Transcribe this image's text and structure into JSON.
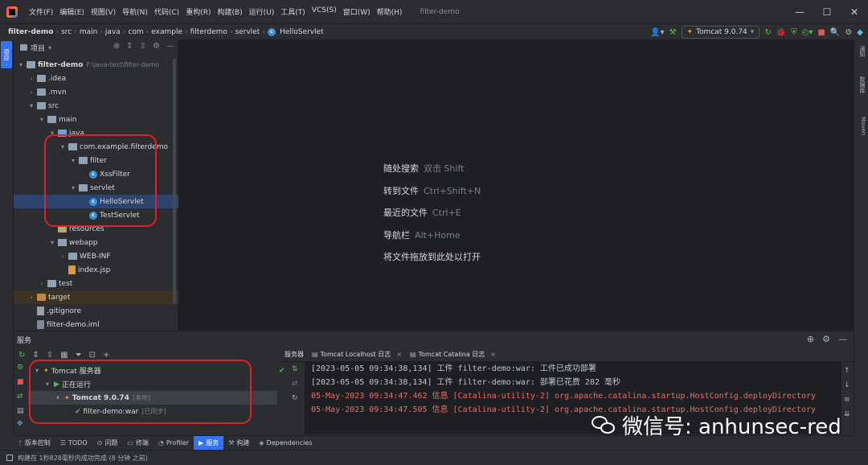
{
  "window": {
    "title": "filter-demo",
    "menu": [
      "文件(F)",
      "编辑(E)",
      "视图(V)",
      "导航(N)",
      "代码(C)",
      "重构(R)",
      "构建(B)",
      "运行(U)",
      "工具(T)",
      "VCS(S)",
      "窗口(W)",
      "帮助(H)"
    ],
    "controls": {
      "minimize": "—",
      "maximize": "☐",
      "close": "✕"
    }
  },
  "breadcrumb": [
    "filter-demo",
    "src",
    "main",
    "java",
    "com",
    "example",
    "filterdemo",
    "servlet",
    "HelloServlet"
  ],
  "run_config": {
    "label": "Tomcat 9.0.74"
  },
  "left_stripe": {
    "project_label": "项目"
  },
  "project_panel": {
    "title": "项目",
    "tree": [
      {
        "label": "filter-demo",
        "hint": "F:\\java-test\\filter-demo",
        "depth": 0,
        "chev": "▾",
        "icon": "folder"
      },
      {
        "label": ".idea",
        "depth": 1,
        "chev": "›",
        "icon": "folder"
      },
      {
        "label": ".mvn",
        "depth": 1,
        "chev": "›",
        "icon": "folder"
      },
      {
        "label": "src",
        "depth": 1,
        "chev": "▾",
        "icon": "folder"
      },
      {
        "label": "main",
        "depth": 2,
        "chev": "▾",
        "icon": "folder"
      },
      {
        "label": "java",
        "depth": 3,
        "chev": "▾",
        "icon": "src"
      },
      {
        "label": "com.example.filterdemo",
        "depth": 4,
        "chev": "▾",
        "icon": "folder"
      },
      {
        "label": "filter",
        "depth": 5,
        "chev": "▾",
        "icon": "folder"
      },
      {
        "label": "XssFilter",
        "depth": 6,
        "chev": "",
        "icon": "class"
      },
      {
        "label": "servlet",
        "depth": 5,
        "chev": "▾",
        "icon": "folder"
      },
      {
        "label": "HelloServlet",
        "depth": 6,
        "chev": "",
        "icon": "class",
        "selected": true
      },
      {
        "label": "TestServlet",
        "depth": 6,
        "chev": "",
        "icon": "class"
      },
      {
        "label": "resources",
        "depth": 3,
        "chev": "",
        "icon": "res"
      },
      {
        "label": "webapp",
        "depth": 3,
        "chev": "▾",
        "icon": "folder"
      },
      {
        "label": "WEB-INF",
        "depth": 4,
        "chev": "›",
        "icon": "folder"
      },
      {
        "label": "index.jsp",
        "depth": 4,
        "chev": "",
        "icon": "jsp"
      },
      {
        "label": "test",
        "depth": 2,
        "chev": "›",
        "icon": "folder"
      },
      {
        "label": "target",
        "depth": 1,
        "chev": "›",
        "icon": "excl",
        "excluded": true
      },
      {
        "label": ".gitignore",
        "depth": 1,
        "chev": "",
        "icon": "file"
      },
      {
        "label": "filter-demo.iml",
        "depth": 1,
        "chev": "",
        "icon": "iml"
      }
    ]
  },
  "editor_hints": [
    {
      "action": "随处搜索",
      "key": "双击 Shift"
    },
    {
      "action": "转到文件",
      "key": "Ctrl+Shift+N"
    },
    {
      "action": "最近的文件",
      "key": "Ctrl+E"
    },
    {
      "action": "导航栏",
      "key": "Alt+Home"
    },
    {
      "action": "将文件拖放到此处以打开",
      "key": ""
    }
  ],
  "right_stripe": [
    "通知",
    "数据库",
    "Maven"
  ],
  "services": {
    "title": "服务",
    "tree": [
      {
        "label": "Tomcat 服务器",
        "depth": 0,
        "chev": "▾",
        "icon": "tomcat"
      },
      {
        "label": "正在运行",
        "depth": 1,
        "chev": "▾",
        "icon": "play"
      },
      {
        "label": "Tomcat 9.0.74",
        "hint": "[本地]",
        "depth": 2,
        "chev": "▾",
        "icon": "tomcat",
        "selected": true,
        "bold": true
      },
      {
        "label": "filter-demo:war",
        "hint": "[已同步]",
        "depth": 3,
        "chev": "",
        "icon": "check"
      }
    ],
    "log_tabs": [
      {
        "label": "服务器"
      },
      {
        "label": "Tomcat Localhost 日志",
        "closable": true
      },
      {
        "label": "Tomcat Catalina 日志",
        "closable": true
      }
    ],
    "log_lines": [
      {
        "text": "[2023-05-05 09:34:38,134] 工件 filter-demo:war: 工件已成功部署",
        "level": "info"
      },
      {
        "text": "[2023-05-05 09:34:38,134] 工件 filter-demo:war: 部署已花费 282 毫秒",
        "level": "info"
      },
      {
        "text": "05-May-2023 09:34:47.462 信息 [Catalina-utility-2] org.apache.catalina.startup.HostConfig.deployDirectory",
        "level": "err"
      },
      {
        "text": "05-May-2023 09:34:47.505 信息 [Catalina-utility-2] org.apache.catalina.startup.HostConfig.deployDirectory",
        "level": "err"
      }
    ]
  },
  "bottom_tabs": [
    {
      "label": "版本控制",
      "icon": "ᚠ"
    },
    {
      "label": "TODO",
      "icon": "☰"
    },
    {
      "label": "问题",
      "icon": "⊙"
    },
    {
      "label": "终端",
      "icon": "▭"
    },
    {
      "label": "Profiler",
      "icon": "◔"
    },
    {
      "label": "服务",
      "icon": "▶",
      "active": true
    },
    {
      "label": "构建",
      "icon": "⚒"
    },
    {
      "label": "Dependencies",
      "icon": "◈"
    }
  ],
  "status_bar": {
    "text": "构建在 1秒828毫秒内成功完成 (8 分钟 之前)"
  },
  "watermark": {
    "text": "微信号: anhunsec-red"
  }
}
